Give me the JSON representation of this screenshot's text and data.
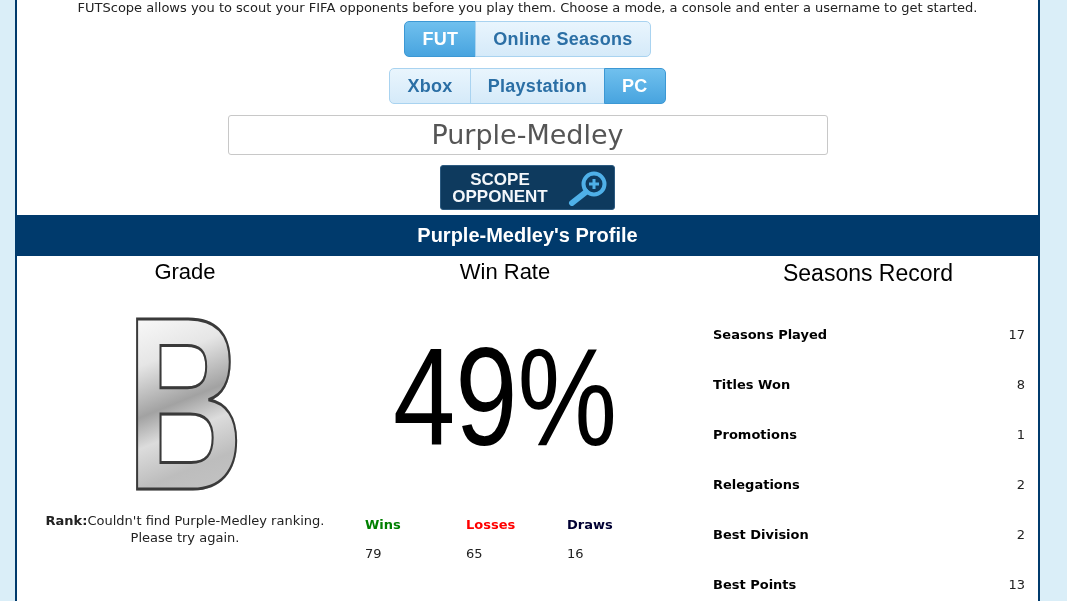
{
  "intro": "FUTScope allows you to scout your FIFA opponents before you play them. Choose a mode, a console and enter a username to get started.",
  "mode_toggle": [
    {
      "label": "FUT",
      "selected": true
    },
    {
      "label": "Online Seasons",
      "selected": false
    }
  ],
  "console_toggle": [
    {
      "label": "Xbox",
      "selected": false
    },
    {
      "label": "Playstation",
      "selected": false
    },
    {
      "label": "PC",
      "selected": true
    }
  ],
  "username_field": {
    "value": "Purple-Medley"
  },
  "scope_button": {
    "label": "SCOPE OPPONENT"
  },
  "profile": {
    "title": "Purple-Medley's Profile",
    "grade": {
      "heading": "Grade",
      "letter": "B",
      "rank": "**Rank:**Couldn't find Purple-Medley ranking. Please try again."
    },
    "win_rate": {
      "heading": "Win Rate",
      "value": "49%",
      "results": [
        {
          "label": "Wins",
          "value": "79",
          "color": "#008000"
        },
        {
          "label": "Losses",
          "value": "65",
          "color": "#ff0000"
        },
        {
          "label": "Draws",
          "value": "16",
          "color": "#000033"
        }
      ]
    },
    "seasons_record": {
      "heading": "Seasons Record",
      "rows": [
        {
          "label": "Seasons Played",
          "value": "17"
        },
        {
          "label": "Titles Won",
          "value": "8"
        },
        {
          "label": "Promotions",
          "value": "1"
        },
        {
          "label": "Relegations",
          "value": "2"
        },
        {
          "label": "Best Division",
          "value": "2"
        },
        {
          "label": "Best Points",
          "value": "13"
        }
      ]
    }
  }
}
